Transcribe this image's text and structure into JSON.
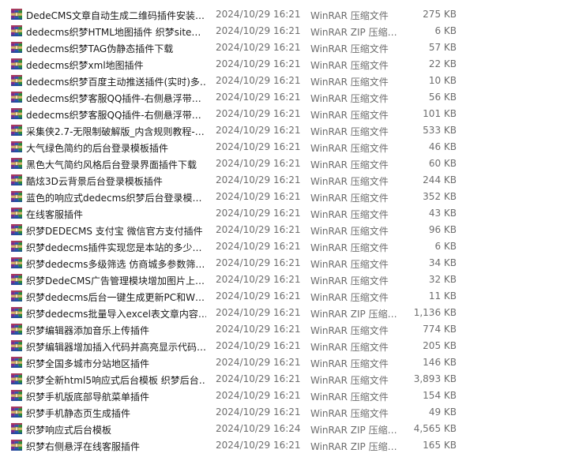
{
  "icon": "winrar-archive-icon",
  "files": [
    {
      "name": "DedeCMS文章自动生成二维码插件安装…",
      "date": "2024/10/29 16:21",
      "type": "WinRAR 压缩文件",
      "size": "275 KB"
    },
    {
      "name": "dedecms织梦HTML地图插件 织梦site…",
      "date": "2024/10/29 16:21",
      "type": "WinRAR ZIP 压缩…",
      "size": "6 KB"
    },
    {
      "name": "dedecms织梦TAG伪静态插件下载",
      "date": "2024/10/29 16:21",
      "type": "WinRAR 压缩文件",
      "size": "57 KB"
    },
    {
      "name": "dedecms织梦xml地图插件",
      "date": "2024/10/29 16:21",
      "type": "WinRAR 压缩文件",
      "size": "22 KB"
    },
    {
      "name": "dedecms织梦百度主动推送插件(实时)多…",
      "date": "2024/10/29 16:21",
      "type": "WinRAR 压缩文件",
      "size": "10 KB"
    },
    {
      "name": "dedecms织梦客服QQ插件-右侧悬浮带…",
      "date": "2024/10/29 16:21",
      "type": "WinRAR 压缩文件",
      "size": "56 KB"
    },
    {
      "name": "dedecms织梦客服QQ插件-右侧悬浮带…",
      "date": "2024/10/29 16:21",
      "type": "WinRAR 压缩文件",
      "size": "101 KB"
    },
    {
      "name": "采集侠2.7-无限制破解版_内含规则教程-…",
      "date": "2024/10/29 16:21",
      "type": "WinRAR 压缩文件",
      "size": "533 KB"
    },
    {
      "name": "大气绿色简约的后台登录模板插件",
      "date": "2024/10/29 16:21",
      "type": "WinRAR 压缩文件",
      "size": "46 KB"
    },
    {
      "name": "黑色大气简约风格后台登录界面插件下载",
      "date": "2024/10/29 16:21",
      "type": "WinRAR 压缩文件",
      "size": "60 KB"
    },
    {
      "name": "酷炫3D云背景后台登录模板插件",
      "date": "2024/10/29 16:21",
      "type": "WinRAR 压缩文件",
      "size": "244 KB"
    },
    {
      "name": "蓝色的响应式dedecms织梦后台登录模…",
      "date": "2024/10/29 16:21",
      "type": "WinRAR 压缩文件",
      "size": "352 KB"
    },
    {
      "name": "在线客服插件",
      "date": "2024/10/29 16:21",
      "type": "WinRAR 压缩文件",
      "size": "43 KB"
    },
    {
      "name": "织梦DEDECMS 支付宝 微信官方支付插件",
      "date": "2024/10/29 16:21",
      "type": "WinRAR 压缩文件",
      "size": "96 KB"
    },
    {
      "name": "织梦dedecms插件实现您是本站的多少…",
      "date": "2024/10/29 16:21",
      "type": "WinRAR 压缩文件",
      "size": "6 KB"
    },
    {
      "name": "织梦dedecms多级筛选 仿商城多参数筛…",
      "date": "2024/10/29 16:21",
      "type": "WinRAR 压缩文件",
      "size": "34 KB"
    },
    {
      "name": "织梦DedeCMS广告管理模块增加图片上…",
      "date": "2024/10/29 16:21",
      "type": "WinRAR 压缩文件",
      "size": "32 KB"
    },
    {
      "name": "织梦dedecms后台一键生成更新PC和W…",
      "date": "2024/10/29 16:21",
      "type": "WinRAR 压缩文件",
      "size": "11 KB"
    },
    {
      "name": "织梦dedecms批量导入excel表文章内容…",
      "date": "2024/10/29 16:21",
      "type": "WinRAR ZIP 压缩…",
      "size": "1,136 KB"
    },
    {
      "name": "织梦编辑器添加音乐上传插件",
      "date": "2024/10/29 16:21",
      "type": "WinRAR 压缩文件",
      "size": "774 KB"
    },
    {
      "name": "织梦编辑器增加插入代码并高亮显示代码…",
      "date": "2024/10/29 16:21",
      "type": "WinRAR 压缩文件",
      "size": "205 KB"
    },
    {
      "name": "织梦全国多城市分站地区插件",
      "date": "2024/10/29 16:21",
      "type": "WinRAR 压缩文件",
      "size": "146 KB"
    },
    {
      "name": "织梦全新html5响应式后台模板 织梦后台…",
      "date": "2024/10/29 16:21",
      "type": "WinRAR 压缩文件",
      "size": "3,893 KB"
    },
    {
      "name": "织梦手机版底部导航菜单插件",
      "date": "2024/10/29 16:21",
      "type": "WinRAR 压缩文件",
      "size": "154 KB"
    },
    {
      "name": "织梦手机静态页生成插件",
      "date": "2024/10/29 16:21",
      "type": "WinRAR 压缩文件",
      "size": "49 KB"
    },
    {
      "name": "织梦响应式后台模板",
      "date": "2024/10/29 16:24",
      "type": "WinRAR ZIP 压缩…",
      "size": "4,565 KB"
    },
    {
      "name": "织梦右侧悬浮在线客服插件",
      "date": "2024/10/29 16:21",
      "type": "WinRAR ZIP 压缩…",
      "size": "165 KB"
    }
  ]
}
